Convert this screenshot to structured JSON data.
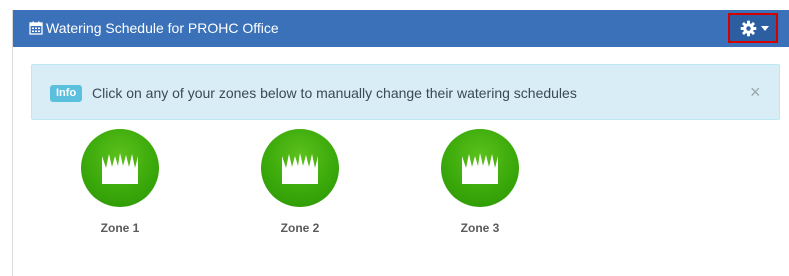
{
  "header": {
    "title": "Watering Schedule for PROHC Office",
    "calendar_icon": "calendar-icon",
    "settings_icon": "gear-icon"
  },
  "alert": {
    "badge": "Info",
    "message": "Click on any of your zones below to manually change their watering schedules",
    "close": "×"
  },
  "zones": [
    {
      "label": "Zone 1",
      "icon": "grass-icon"
    },
    {
      "label": "Zone 2",
      "icon": "grass-icon"
    },
    {
      "label": "Zone 3",
      "icon": "grass-icon"
    }
  ],
  "colors": {
    "header_bg": "#3a71b8",
    "highlight_border": "#d40000",
    "alert_bg": "#d9edf7",
    "badge_bg": "#5bc0de",
    "zone_green": "#3aa90a"
  }
}
